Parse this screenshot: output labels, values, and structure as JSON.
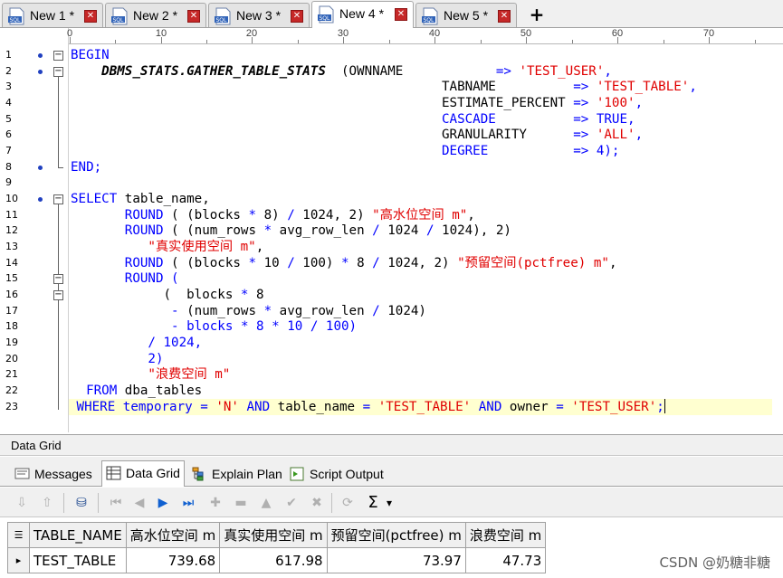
{
  "tabs": [
    {
      "label": "New 1 *"
    },
    {
      "label": "New 2 *"
    },
    {
      "label": "New 3 *"
    },
    {
      "label": "New 4 *"
    },
    {
      "label": "New 5 *"
    }
  ],
  "tab_icon_text": "SQL",
  "tab_close_glyph": "✕",
  "tab_add_glyph": "+",
  "ruler": {
    "labels": [
      "0",
      "10",
      "20",
      "30",
      "40",
      "50",
      "60",
      "70"
    ]
  },
  "line_numbers": [
    "1",
    "2",
    "3",
    "4",
    "5",
    "6",
    "7",
    "8",
    "9",
    "10",
    "11",
    "12",
    "13",
    "14",
    "15",
    "16",
    "17",
    "18",
    "19",
    "20",
    "21",
    "22",
    "23"
  ],
  "code": {
    "l1": {
      "a": "BEGIN"
    },
    "l2": {
      "a": "    ",
      "b": "DBMS_STATS.GATHER_TABLE_STATS",
      "c": "  (OWNNAME            ",
      "d": "=> ",
      "e": "'TEST_USER'",
      "f": ","
    },
    "l3": {
      "a": "                                                ",
      "b": "TABNAME          ",
      "c": "=> ",
      "d": "'TEST_TABLE'",
      "e": ","
    },
    "l4": {
      "a": "                                                ",
      "b": "ESTIMATE_PERCENT ",
      "c": "=> ",
      "d": "'100'",
      "e": ","
    },
    "l5": {
      "a": "                                                ",
      "b": "CASCADE          ",
      "c": "=> ",
      "d": "TRUE",
      "e": ","
    },
    "l6": {
      "a": "                                                ",
      "b": "GRANULARITY      ",
      "c": "=> ",
      "d": "'ALL'",
      "e": ","
    },
    "l7": {
      "a": "                                                ",
      "b": "DEGREE           ",
      "c": "=> ",
      "d": "4",
      "e": ");"
    },
    "l8": {
      "a": "END",
      "b": ";"
    },
    "l10": {
      "a": "SELECT",
      "b": " table_name,"
    },
    "l11": {
      "a": "       ",
      "b": "ROUND",
      "c": " ( (blocks ",
      "d": "*",
      "e": " 8) ",
      "f": "/",
      "g": " 1024, 2) ",
      "h": "\"高水位空间 m\"",
      "i": ","
    },
    "l12": {
      "a": "       ",
      "b": "ROUND",
      "c": " ( (num_rows ",
      "d": "*",
      "e": " avg_row_len ",
      "f": "/",
      "g": " 1024 ",
      "h": "/",
      "i": " 1024), 2)"
    },
    "l13": {
      "a": "          ",
      "b": "\"真实使用空间 m\"",
      "c": ","
    },
    "l14": {
      "a": "       ",
      "b": "ROUND",
      "c": " ( (blocks ",
      "d": "*",
      "e": " 10 ",
      "f": "/",
      "g": " 100) ",
      "h": "*",
      "i": " 8 ",
      "j": "/",
      "k": " 1024, 2) ",
      "l": "\"预留空间(pctfree) m\"",
      "m": ","
    },
    "l15": {
      "a": "       ",
      "b": "ROUND",
      "c": " ("
    },
    "l16": {
      "a": "            (  blocks ",
      "b": "*",
      "c": " 8"
    },
    "l17": {
      "a": "             ",
      "b": "-",
      "c": " (num_rows ",
      "d": "*",
      "e": " avg_row_len ",
      "f": "/",
      "g": " 1024)"
    },
    "l18": {
      "a": "             ",
      "b": "-",
      "c": " blocks ",
      "d": "*",
      "e": " 8 ",
      "f": "*",
      "g": " 10 ",
      "h": "/",
      "i": " 100)"
    },
    "l19": {
      "a": "          ",
      "b": "/",
      "c": " 1024,"
    },
    "l20": {
      "a": "          2)"
    },
    "l21": {
      "a": "          ",
      "b": "\"浪费空间 m\""
    },
    "l22": {
      "a": "  ",
      "b": "FROM",
      "c": " dba_tables"
    },
    "l23": {
      "a": " ",
      "b": "WHERE",
      "c": " temporary ",
      "d": "=",
      "e": " ",
      "f": "'N'",
      "g": " ",
      "h": "AND",
      "i": " table_name ",
      "j": "=",
      "k": " ",
      "l": "'TEST_TABLE'",
      "m": " ",
      "n": "AND",
      "o": " owner ",
      "p": "=",
      "q": " ",
      "r": "'TEST_USER'",
      "s": ";"
    }
  },
  "panel": {
    "title": "Data Grid"
  },
  "subtabs": [
    {
      "label": "Messages"
    },
    {
      "label": "Data Grid"
    },
    {
      "label": "Explain Plan"
    },
    {
      "label": "Script Output"
    }
  ],
  "toolbar": {
    "sigma": "Σ",
    "dropdown": "▾"
  },
  "grid": {
    "columns": [
      "TABLE_NAME",
      "高水位空间 m",
      "真实使用空间 m",
      "预留空间(pctfree) m",
      "浪费空间 m"
    ],
    "rows": [
      {
        "indicator": "▸",
        "cells": [
          "TEST_TABLE",
          "739.68",
          "617.98",
          "73.97",
          "47.73"
        ]
      }
    ]
  },
  "watermark": "CSDN @奶糖非糖",
  "colors": {
    "keyword": "#0000ff",
    "string": "#e00000",
    "tab_close": "#c62828",
    "current_line": "#ffffd0"
  }
}
